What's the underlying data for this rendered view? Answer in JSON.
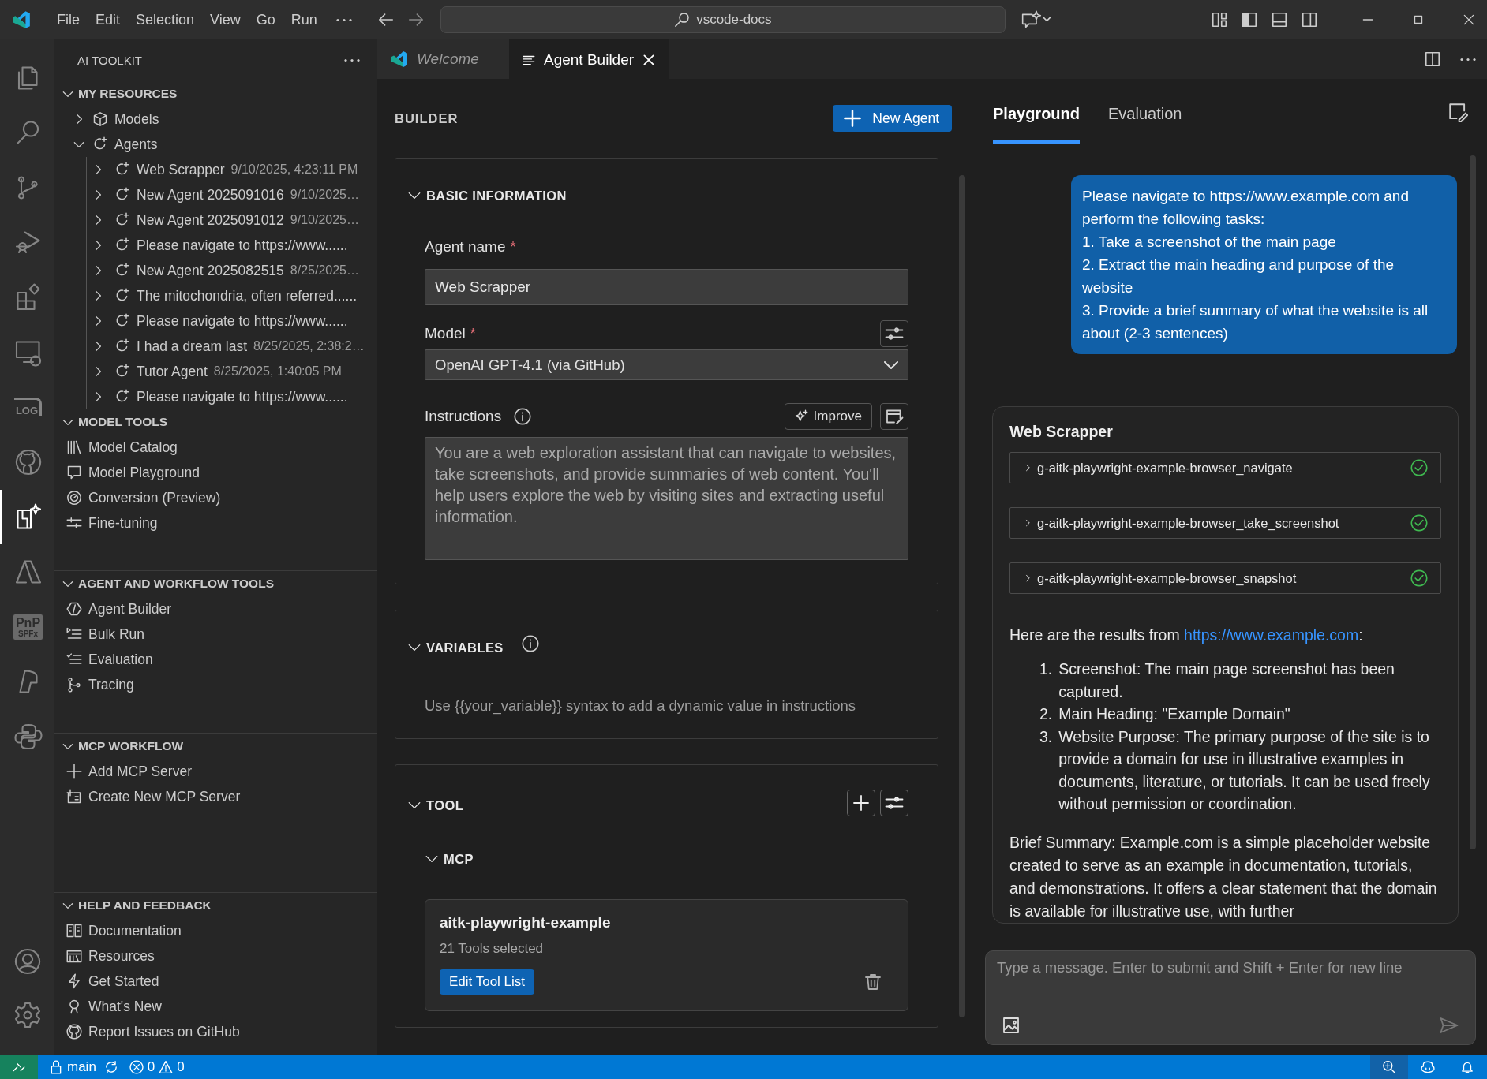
{
  "title_bar": {
    "menu": [
      "File",
      "Edit",
      "Selection",
      "View",
      "Go",
      "Run"
    ],
    "search": "vscode-docs"
  },
  "activity_bar": [
    {
      "kind": "files",
      "selected": false
    },
    {
      "kind": "search",
      "selected": false
    },
    {
      "kind": "source-control",
      "selected": false
    },
    {
      "kind": "run",
      "selected": false
    },
    {
      "kind": "extensions",
      "selected": false
    },
    {
      "kind": "remote",
      "selected": false
    },
    {
      "kind": "log",
      "label": "LOG",
      "selected": false
    },
    {
      "kind": "github",
      "selected": false
    },
    {
      "kind": "toolkit",
      "selected": true
    },
    {
      "kind": "azure",
      "selected": false
    },
    {
      "kind": "pnp",
      "label": "PnP",
      "sublabel": "SPFx",
      "selected": false
    },
    {
      "kind": "feather",
      "selected": false
    },
    {
      "kind": "python",
      "selected": false
    }
  ],
  "sidebar": {
    "title": "AI TOOLKIT",
    "sections": [
      {
        "title": "MY RESOURCES",
        "expanded": true,
        "items": [
          {
            "kind": "models",
            "label": "Models",
            "expanded": false
          },
          {
            "kind": "agents",
            "label": "Agents",
            "expanded": true,
            "children": [
              {
                "label": "Web Scrapper",
                "date": "9/10/2025, 4:23:11 PM",
                "expanded": false
              },
              {
                "label": "New Agent 2025091016",
                "date": "9/10/2025…",
                "expanded": false
              },
              {
                "label": "New Agent 2025091012",
                "date": "9/10/2025…",
                "expanded": false
              },
              {
                "label": "Please navigate to https://www......",
                "expanded": false
              },
              {
                "label": "New Agent 2025082515",
                "date": "8/25/2025…",
                "expanded": false
              },
              {
                "label": "The mitochondria, often referred......",
                "expanded": false
              },
              {
                "label": "Please navigate to https://www......",
                "expanded": false
              },
              {
                "label": "I had a dream last",
                "date": "8/25/2025, 2:38:2…",
                "expanded": false
              },
              {
                "label": "Tutor Agent",
                "date": "8/25/2025, 1:40:05 PM",
                "expanded": false
              },
              {
                "label": "Please navigate to https://www......",
                "expanded": false
              }
            ]
          }
        ]
      },
      {
        "title": "MODEL TOOLS",
        "expanded": true,
        "items": [
          {
            "kind": "catalog",
            "label": "Model Catalog"
          },
          {
            "kind": "playground",
            "label": "Model Playground"
          },
          {
            "kind": "conversion",
            "label": "Conversion (Preview)"
          },
          {
            "kind": "tuning",
            "label": "Fine-tuning"
          }
        ]
      },
      {
        "title": "AGENT AND WORKFLOW TOOLS",
        "expanded": true,
        "items": [
          {
            "kind": "agent-builder",
            "label": "Agent Builder"
          },
          {
            "kind": "bulk-run",
            "label": "Bulk Run"
          },
          {
            "kind": "evaluation",
            "label": "Evaluation"
          },
          {
            "kind": "tracing",
            "label": "Tracing"
          }
        ]
      },
      {
        "title": "MCP WORKFLOW",
        "expanded": true,
        "items": [
          {
            "kind": "add",
            "label": "Add MCP Server"
          },
          {
            "kind": "create-server",
            "label": "Create New MCP Server"
          }
        ]
      },
      {
        "title": "HELP AND FEEDBACK",
        "expanded": true,
        "items": [
          {
            "kind": "docs",
            "label": "Documentation"
          },
          {
            "kind": "resources",
            "label": "Resources"
          },
          {
            "kind": "get-started",
            "label": "Get Started"
          },
          {
            "kind": "whats-new",
            "label": "What's New"
          },
          {
            "kind": "github",
            "label": "Report Issues on GitHub"
          }
        ]
      }
    ]
  },
  "tabs": [
    {
      "label": "Welcome",
      "selected": false,
      "preview": true
    },
    {
      "label": "Agent Builder",
      "selected": true,
      "preview": false
    }
  ],
  "builder": {
    "title": "BUILDER",
    "new_agent": "New Agent",
    "basic": {
      "title": "BASIC INFORMATION",
      "expanded": true,
      "name_label": "Agent name",
      "name_value": "Web Scrapper",
      "model_label": "Model",
      "model_value": "OpenAI GPT-4.1 (via GitHub)",
      "instructions_label": "Instructions",
      "improve": "Improve",
      "instructions": "You are a web exploration assistant that can navigate to websites, take screenshots, and provide summaries of web content. You'll help users explore the web by visiting sites and extracting useful information.",
      "required_mark": "*"
    },
    "variables": {
      "title": "VARIABLES",
      "expanded": true,
      "hint": "Use {{your_variable}} syntax to add a dynamic value in instructions"
    },
    "tool": {
      "title": "TOOL",
      "expanded": true,
      "group": "MCP",
      "group_expanded": true,
      "server": {
        "name": "aitk-playwright-example",
        "count": "21 Tools selected",
        "edit": "Edit Tool List"
      }
    }
  },
  "playground": {
    "tabs": [
      {
        "label": "Playground",
        "selected": true
      },
      {
        "label": "Evaluation",
        "selected": false
      }
    ],
    "user_message": [
      "Please navigate to https://www.example.com and perform the following tasks:",
      "1. Take a screenshot of the main page",
      "2. Extract the main heading and purpose of the website",
      "3. Provide a brief summary of what the website is all about (2-3 sentences)"
    ],
    "response": {
      "agent": "Web Scrapper",
      "tool_calls": [
        {
          "name": "g-aitk-playwright-example-browser_navigate",
          "succeeded": true
        },
        {
          "name": "g-aitk-playwright-example-browser_take_screenshot",
          "succeeded": true
        },
        {
          "name": "g-aitk-playwright-example-browser_snapshot",
          "succeeded": true
        }
      ],
      "intro": "Here are the results from",
      "link": "https://www.example.com",
      "intro_end": ":",
      "list": [
        {
          "number": "1.",
          "text": "Screenshot: The main page screenshot has been captured."
        },
        {
          "number": "2.",
          "text": "Main Heading: \"Example Domain\""
        },
        {
          "number": "3.",
          "text": "Website Purpose: The primary purpose of the site is to provide a domain for use in illustrative examples in documents, literature, or tutorials. It can be used freely without permission or coordination."
        }
      ],
      "summary": "Brief Summary: Example.com is a simple placeholder website created to serve as an example in documentation, tutorials, and demonstrations. It offers a clear statement that the domain is available for illustrative use, with further"
    },
    "input_placeholder": "Type a message. Enter to submit and Shift + Enter for new line"
  },
  "status_bar": {
    "branch": "main",
    "errors": "0",
    "warnings": "0"
  }
}
